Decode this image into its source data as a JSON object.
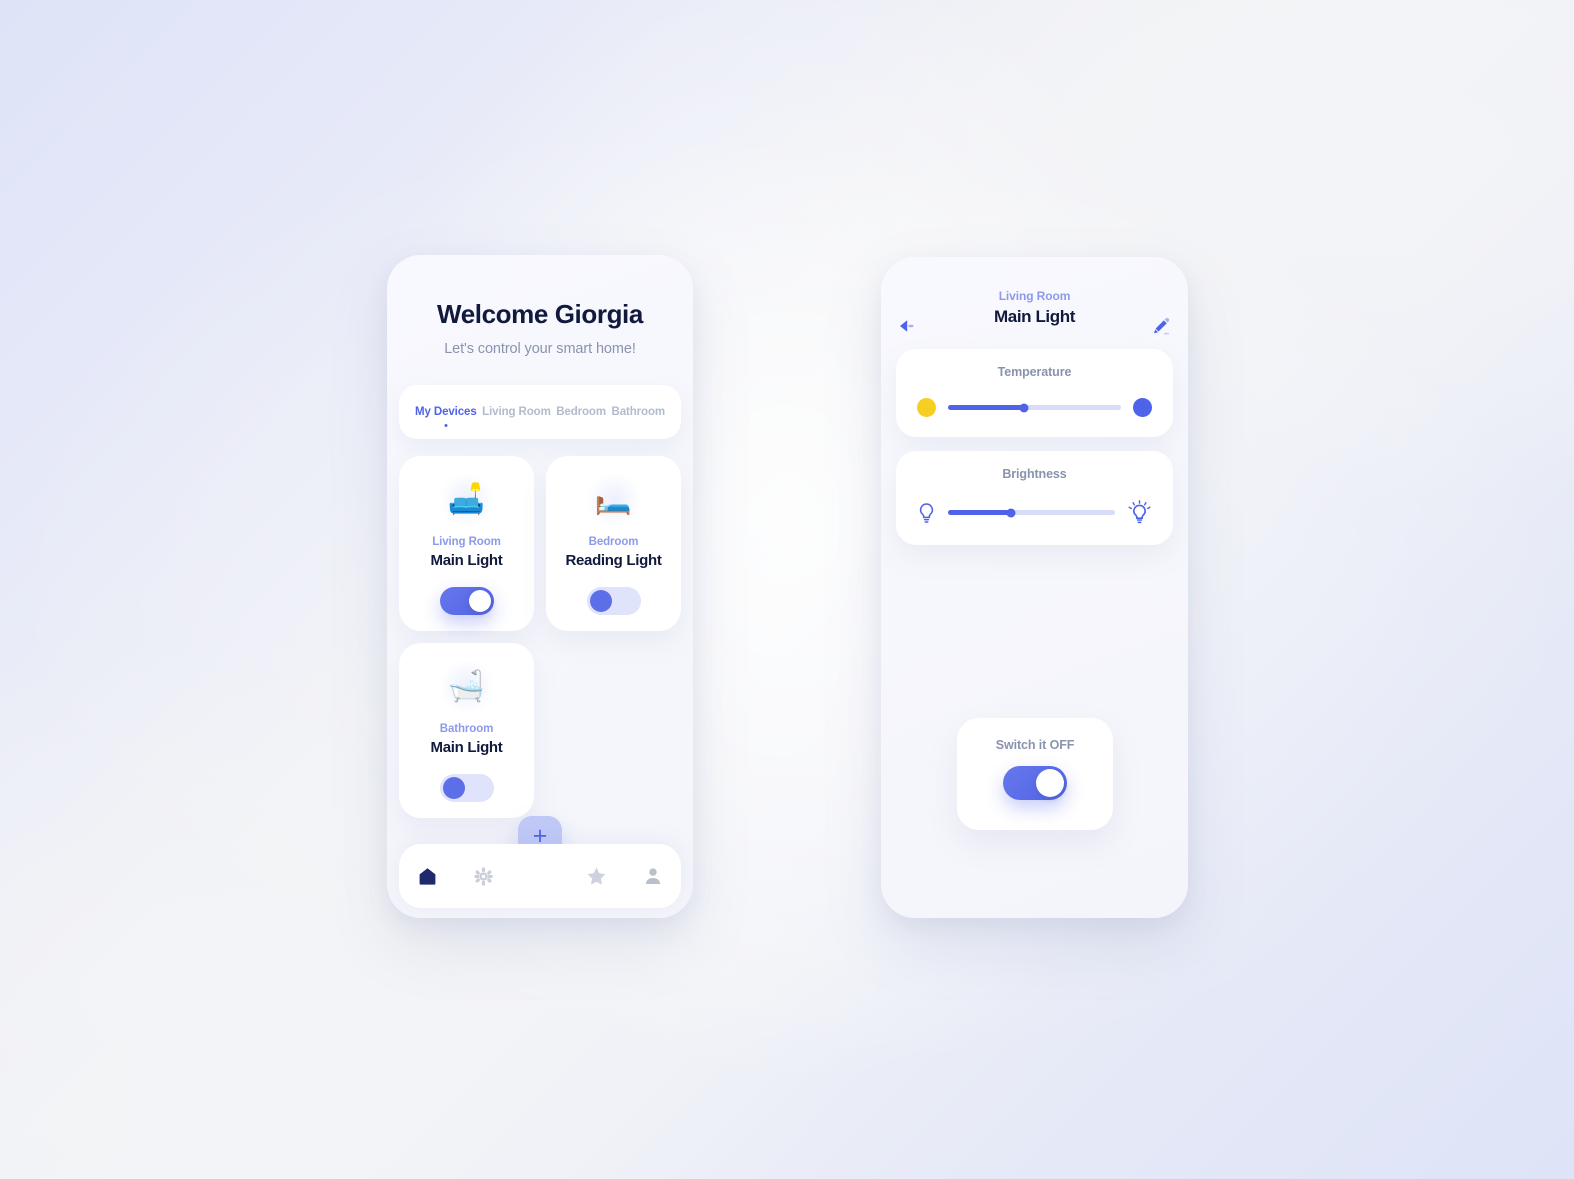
{
  "theme": {
    "accent": "#4f63e8",
    "accent_soft": "#8d9ae8",
    "toggle_on": "#5c6fe9",
    "toggle_off_track": "#dfe3fb",
    "warm_dot": "#f7cf22",
    "text_dark": "#111a3c",
    "text_muted": "#8a93ad",
    "card_bg": "#ffffff",
    "phone_bg": "#f7f8fd",
    "bg_blue": "#dee3f7",
    "bg_gray": "#f3f4f7"
  },
  "home": {
    "greeting": "Welcome Giorgia",
    "subtitle": "Let's control your smart home!",
    "tabs": [
      {
        "label": "My Devices",
        "active": true
      },
      {
        "label": "Living Room",
        "active": false
      },
      {
        "label": "Bedroom",
        "active": false
      },
      {
        "label": "Bathroom",
        "active": false
      }
    ],
    "devices": [
      {
        "room": "Living Room",
        "name": "Main Light",
        "emoji": "🛋️",
        "icon_name": "couch-lamp-icon",
        "state": "on"
      },
      {
        "room": "Bedroom",
        "name": "Reading Light",
        "emoji": "🛏️",
        "icon_name": "bed-icon",
        "state": "off"
      },
      {
        "room": "Bathroom",
        "name": "Main Light",
        "emoji": "🛁",
        "icon_name": "bathtub-icon",
        "state": "off"
      }
    ],
    "add_button_label": "+",
    "nav": [
      {
        "icon_name": "home-icon",
        "active": true
      },
      {
        "icon_name": "gear-icon",
        "active": false
      },
      {
        "icon_name": "star-icon",
        "active": false
      },
      {
        "icon_name": "profile-icon",
        "active": false
      }
    ]
  },
  "detail": {
    "back_icon": "back-arrow-icon",
    "edit_icon": "pencil-icon",
    "room": "Living Room",
    "name": "Main Light",
    "sliders": [
      {
        "label": "Temperature",
        "value_percent": 44,
        "left_icon": "warm-dot-icon",
        "right_icon": "cool-dot-icon"
      },
      {
        "label": "Brightness",
        "value_percent": 38,
        "left_icon": "bulb-dim-icon",
        "right_icon": "bulb-bright-icon"
      }
    ],
    "switch": {
      "label": "Switch it OFF",
      "state": "on"
    }
  }
}
